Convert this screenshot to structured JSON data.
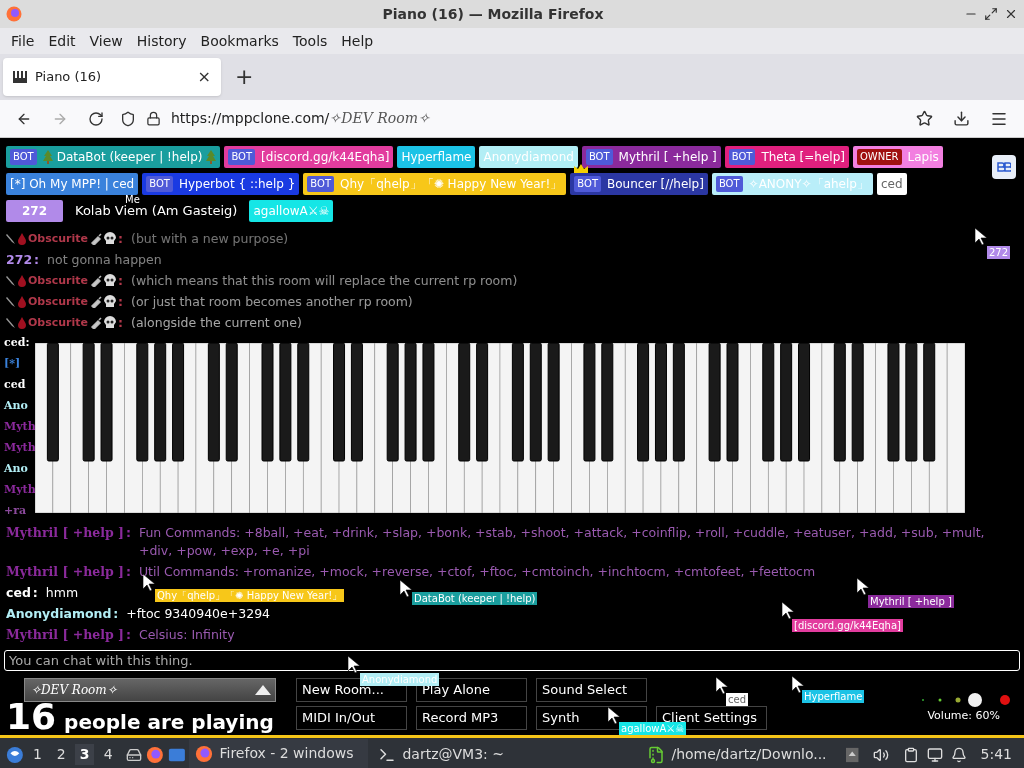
{
  "window": {
    "title": "Piano (16) — Mozilla Firefox"
  },
  "menu": [
    "File",
    "Edit",
    "View",
    "History",
    "Bookmarks",
    "Tools",
    "Help"
  ],
  "tab": {
    "title": "Piano (16)",
    "close": "×",
    "new": "+"
  },
  "address": {
    "host": "https://mppclone.com/",
    "room": "✧DEV Room✧"
  },
  "user_rows": [
    [
      {
        "tag": "BOT",
        "name": "DataBot (keeper | !help)",
        "color": "#1a9e9e",
        "kind": "xmas"
      },
      {
        "tag": "BOT",
        "name": "[discord.gg/k44Eqha]",
        "color": "#e23c9e",
        "kind": "plain"
      },
      {
        "name": "Hyperflame",
        "color": "#1cc3e6",
        "kind": "plain"
      },
      {
        "name": "Anonydiamond",
        "color": "#b2eef5",
        "kind": "plain"
      },
      {
        "tag": "BOT",
        "name": "Mythril [ +help ]",
        "color": "#8b2a9c",
        "kind": "plain"
      },
      {
        "tag": "BOT",
        "name": "Theta [=help]",
        "color": "#e0207e",
        "kind": "plain"
      },
      {
        "tag": "OWNER",
        "name": "Lapis",
        "color": "#f27fe0",
        "kind": "plain"
      }
    ],
    [
      {
        "name": "[*] Oh My MPP! | ced",
        "color": "#3a82dc",
        "kind": "plain"
      },
      {
        "tag": "BOT",
        "name": "Hyperbot { ::help }",
        "color": "#1a3ae2",
        "kind": "plain"
      },
      {
        "tag": "BOT",
        "name": "Qhy「qhelp」「✺ Happy New Year!」",
        "color": "#f7c719",
        "kind": "plain"
      },
      {
        "tag": "BOT",
        "name": "Bouncer [//help]",
        "color": "#2b37a3",
        "kind": "crown"
      },
      {
        "tag": "BOT",
        "name": "✧ANONY✧「ahelp」",
        "color": "#b9eef9",
        "kind": "plain"
      },
      {
        "name": "ced",
        "color": "#ffffff",
        "kind": "plain"
      }
    ],
    [
      {
        "name": "272",
        "color": "#b18ae9",
        "kind": "wide"
      },
      {
        "name": "Kolab Viem (Am Gasteig)",
        "kind": "self",
        "me": "Me"
      },
      {
        "name": "agallowA⚔☠",
        "color": "#15e6e6",
        "kind": "plain"
      }
    ]
  ],
  "messages": [
    {
      "kind": "decorated",
      "name": "Obscurite",
      "sep": ":",
      "color": "#b0384a",
      "text": "(but with a new purpose)"
    },
    {
      "kind": "user",
      "name": "272",
      "sep": ":",
      "color": "#b18ae9",
      "text": "not gonna happen"
    },
    {
      "kind": "decorated",
      "name": "Obscurite",
      "sep": ":",
      "color": "#b0384a",
      "text": "(which means that this room will replace the current rp room)"
    },
    {
      "kind": "decorated",
      "name": "Obscurite",
      "sep": ":",
      "color": "#b0384a",
      "text": "(or just that room becomes another rp room)"
    },
    {
      "kind": "decorated",
      "name": "Obscurite",
      "sep": ":",
      "color": "#b0384a",
      "text": "(alongside the current one)"
    },
    {
      "kind": "fragment",
      "text": "ced:",
      "color": "#ffffff"
    },
    {
      "kind": "fragment",
      "text": "[*]",
      "color": "#3a82dc"
    },
    {
      "kind": "fragment",
      "text": "ced",
      "color": "#ffffff"
    },
    {
      "kind": "fragment",
      "text": "Ano",
      "color": "#b2eef5"
    },
    {
      "kind": "fragment",
      "text": "Myth",
      "color": "#8b2a9c"
    },
    {
      "kind": "fragment",
      "text": "Myth",
      "color": "#8b2a9c"
    },
    {
      "kind": "fragment",
      "text": "Ano",
      "color": "#b2eef5"
    },
    {
      "kind": "fragment",
      "text": "Myth",
      "color": "#8b2a9c"
    },
    {
      "kind": "fragment",
      "text": "+ra",
      "color": "#8b4a9c"
    },
    {
      "kind": "bot",
      "name": "Mythril [ +help ]",
      "sep": ":",
      "color": "#8b2a9c",
      "text": "Fun Commands: +8ball, +eat, +drink, +slap, +bonk, +stab, +shoot, +attack, +coinflip, +roll, +cuddle, +eatuser, +add, +sub, +mult, +div, +pow, +exp, +e, +pi"
    },
    {
      "kind": "bot",
      "name": "Mythril [ +help ]",
      "sep": ":",
      "color": "#8b2a9c",
      "text": "Util Commands: +romanize, +mock, +reverse, +ctof, +ftoc, +cmtoinch, +inchtocm, +cmtofeet, +feettocm"
    },
    {
      "kind": "user",
      "name": "ced",
      "sep": ":",
      "color": "#ffffff",
      "text": "hmm"
    },
    {
      "kind": "user",
      "name": "Anonydiamond",
      "sep": ":",
      "color": "#b2eef5",
      "text": "+ftoc 9340940e+3294"
    },
    {
      "kind": "bot",
      "name": "Mythril [ +help ]",
      "sep": ":",
      "color": "#8b2a9c",
      "text": "Celsius: Infinity"
    }
  ],
  "chat_input": {
    "placeholder": "You can chat with this thing."
  },
  "cursors": [
    {
      "label": "Qhy「qhelp」「✺ Happy New Year!」",
      "color": "#f7c719"
    },
    {
      "label": "DataBot (keeper | !help)",
      "color": "#1a9e9e"
    },
    {
      "label": "272",
      "color": "#b18ae9"
    },
    {
      "label": "Mythril [ +help ]",
      "color": "#8b2a9c"
    },
    {
      "label": "[discord.gg/k44Eqha]",
      "color": "#e23c9e"
    },
    {
      "label": "Anonydiamond",
      "color": "#b2eef5"
    },
    {
      "label": "Hyperflame",
      "color": "#1cc3e6"
    },
    {
      "label": "ced",
      "color": "#ffffff"
    },
    {
      "label": "agallowA⚔☠",
      "color": "#15e6e6"
    }
  ],
  "room_select": {
    "value": "✧DEV Room✧"
  },
  "players": {
    "count": "16",
    "label": "people are playing"
  },
  "buttons": [
    [
      "New Room...",
      "Play Alone",
      "Sound Select"
    ],
    [
      "MIDI In/Out",
      "Record MP3",
      "Synth",
      "Client Settings"
    ]
  ],
  "volume": {
    "reading": "Volume: 60%"
  },
  "taskbar": {
    "workspaces": [
      {
        "label": "1",
        "selected": false
      },
      {
        "label": "2",
        "selected": false
      },
      {
        "label": "3",
        "selected": true
      },
      {
        "label": "4",
        "selected": false
      }
    ],
    "tasks": [
      {
        "kind": "browser",
        "label": "Firefox - 2 windows",
        "selected": true
      },
      {
        "kind": "terminal",
        "label": "dartz@VM3: ~",
        "selected": false
      },
      {
        "kind": "archive",
        "label": "/home/dartz/Downlo...",
        "selected": false
      }
    ],
    "clock": "5:41"
  }
}
